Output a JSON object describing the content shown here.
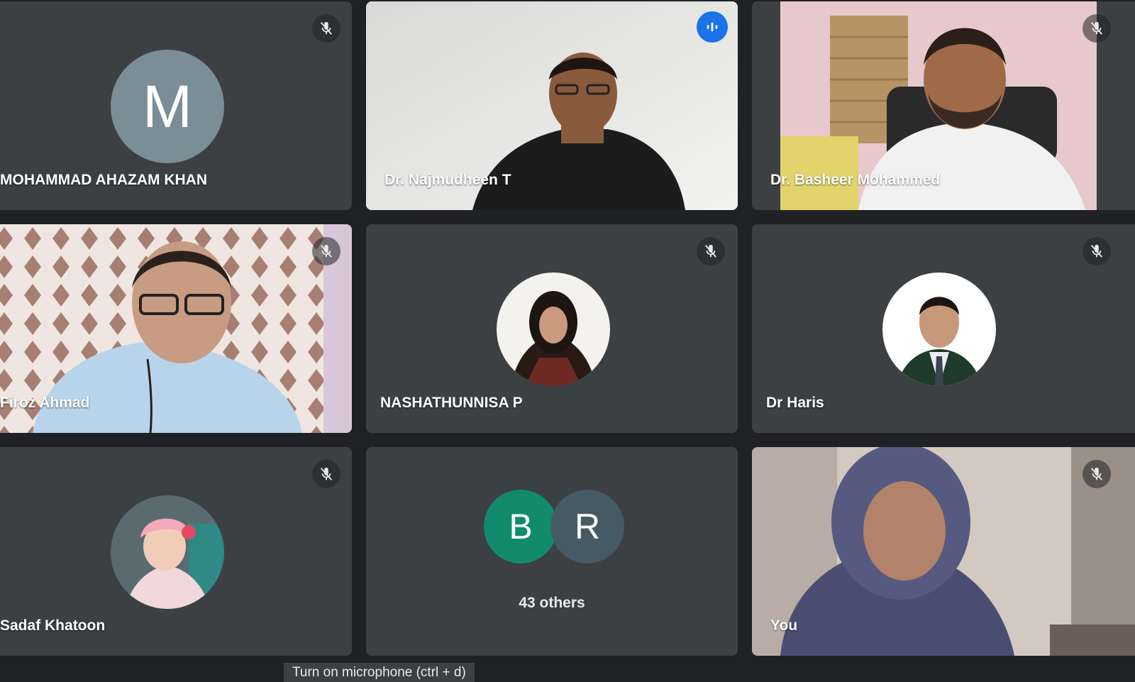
{
  "participants": {
    "ahazam": {
      "name": "MOHAMMAD AHAZAM KHAN",
      "avatar_letter": "M",
      "avatar_color": "#7b8d97",
      "muted": true
    },
    "najmudheen": {
      "name": "Dr. Najmudheen T",
      "speaking": true
    },
    "basheer": {
      "name": "Dr. Basheer Mohammed",
      "muted": true
    },
    "firoz": {
      "name": "Firoz Ahmad",
      "muted": true
    },
    "nashathunnisa": {
      "name": "NASHATHUNNISA P",
      "muted": true
    },
    "haris": {
      "name": "Dr Haris",
      "muted": true
    },
    "sadaf": {
      "name": "Sadaf Khatoon",
      "muted": true
    },
    "others": {
      "label": "43 others",
      "avatars": [
        {
          "letter": "B",
          "color": "#128a6e"
        },
        {
          "letter": "R",
          "color": "#455a64"
        }
      ]
    },
    "you": {
      "name": "You",
      "muted": true
    }
  },
  "tooltip": {
    "text": "Turn on microphone (ctrl + d)"
  },
  "icons": {
    "mute": "mic-off-icon",
    "speaking": "audio-level-icon"
  },
  "colors": {
    "tile": "#3c4043",
    "background": "#202124",
    "active_border": "#8ab4f8",
    "speaking_badge": "#1a73e8"
  }
}
